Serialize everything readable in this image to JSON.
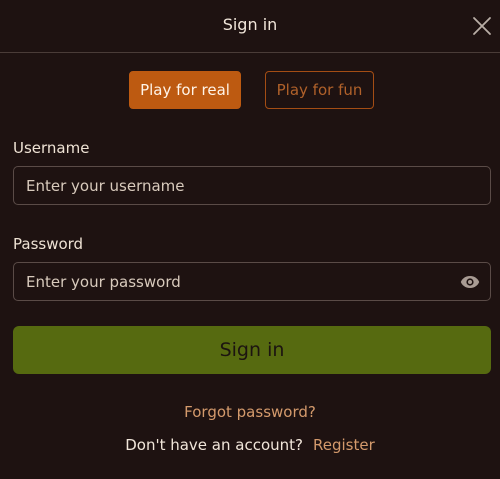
{
  "dialog": {
    "title": "Sign in",
    "close_icon": "close-icon"
  },
  "modes": {
    "real_label": "Play for real",
    "fun_label": "Play for fun",
    "selected": "real"
  },
  "form": {
    "username_label": "Username",
    "username_placeholder": "Enter your username",
    "username_value": "",
    "password_label": "Password",
    "password_placeholder": "Enter your password",
    "password_value": "",
    "password_toggle_icon": "eye-icon",
    "submit_label": "Sign in"
  },
  "footer": {
    "forgot_label": "Forgot password?",
    "no_account_text": "Don't have an account?",
    "register_label": "Register"
  },
  "colors": {
    "background": "#1e1211",
    "accent_orange": "#bd5a11",
    "signin_green": "#566a10",
    "link": "#d49a6c"
  }
}
